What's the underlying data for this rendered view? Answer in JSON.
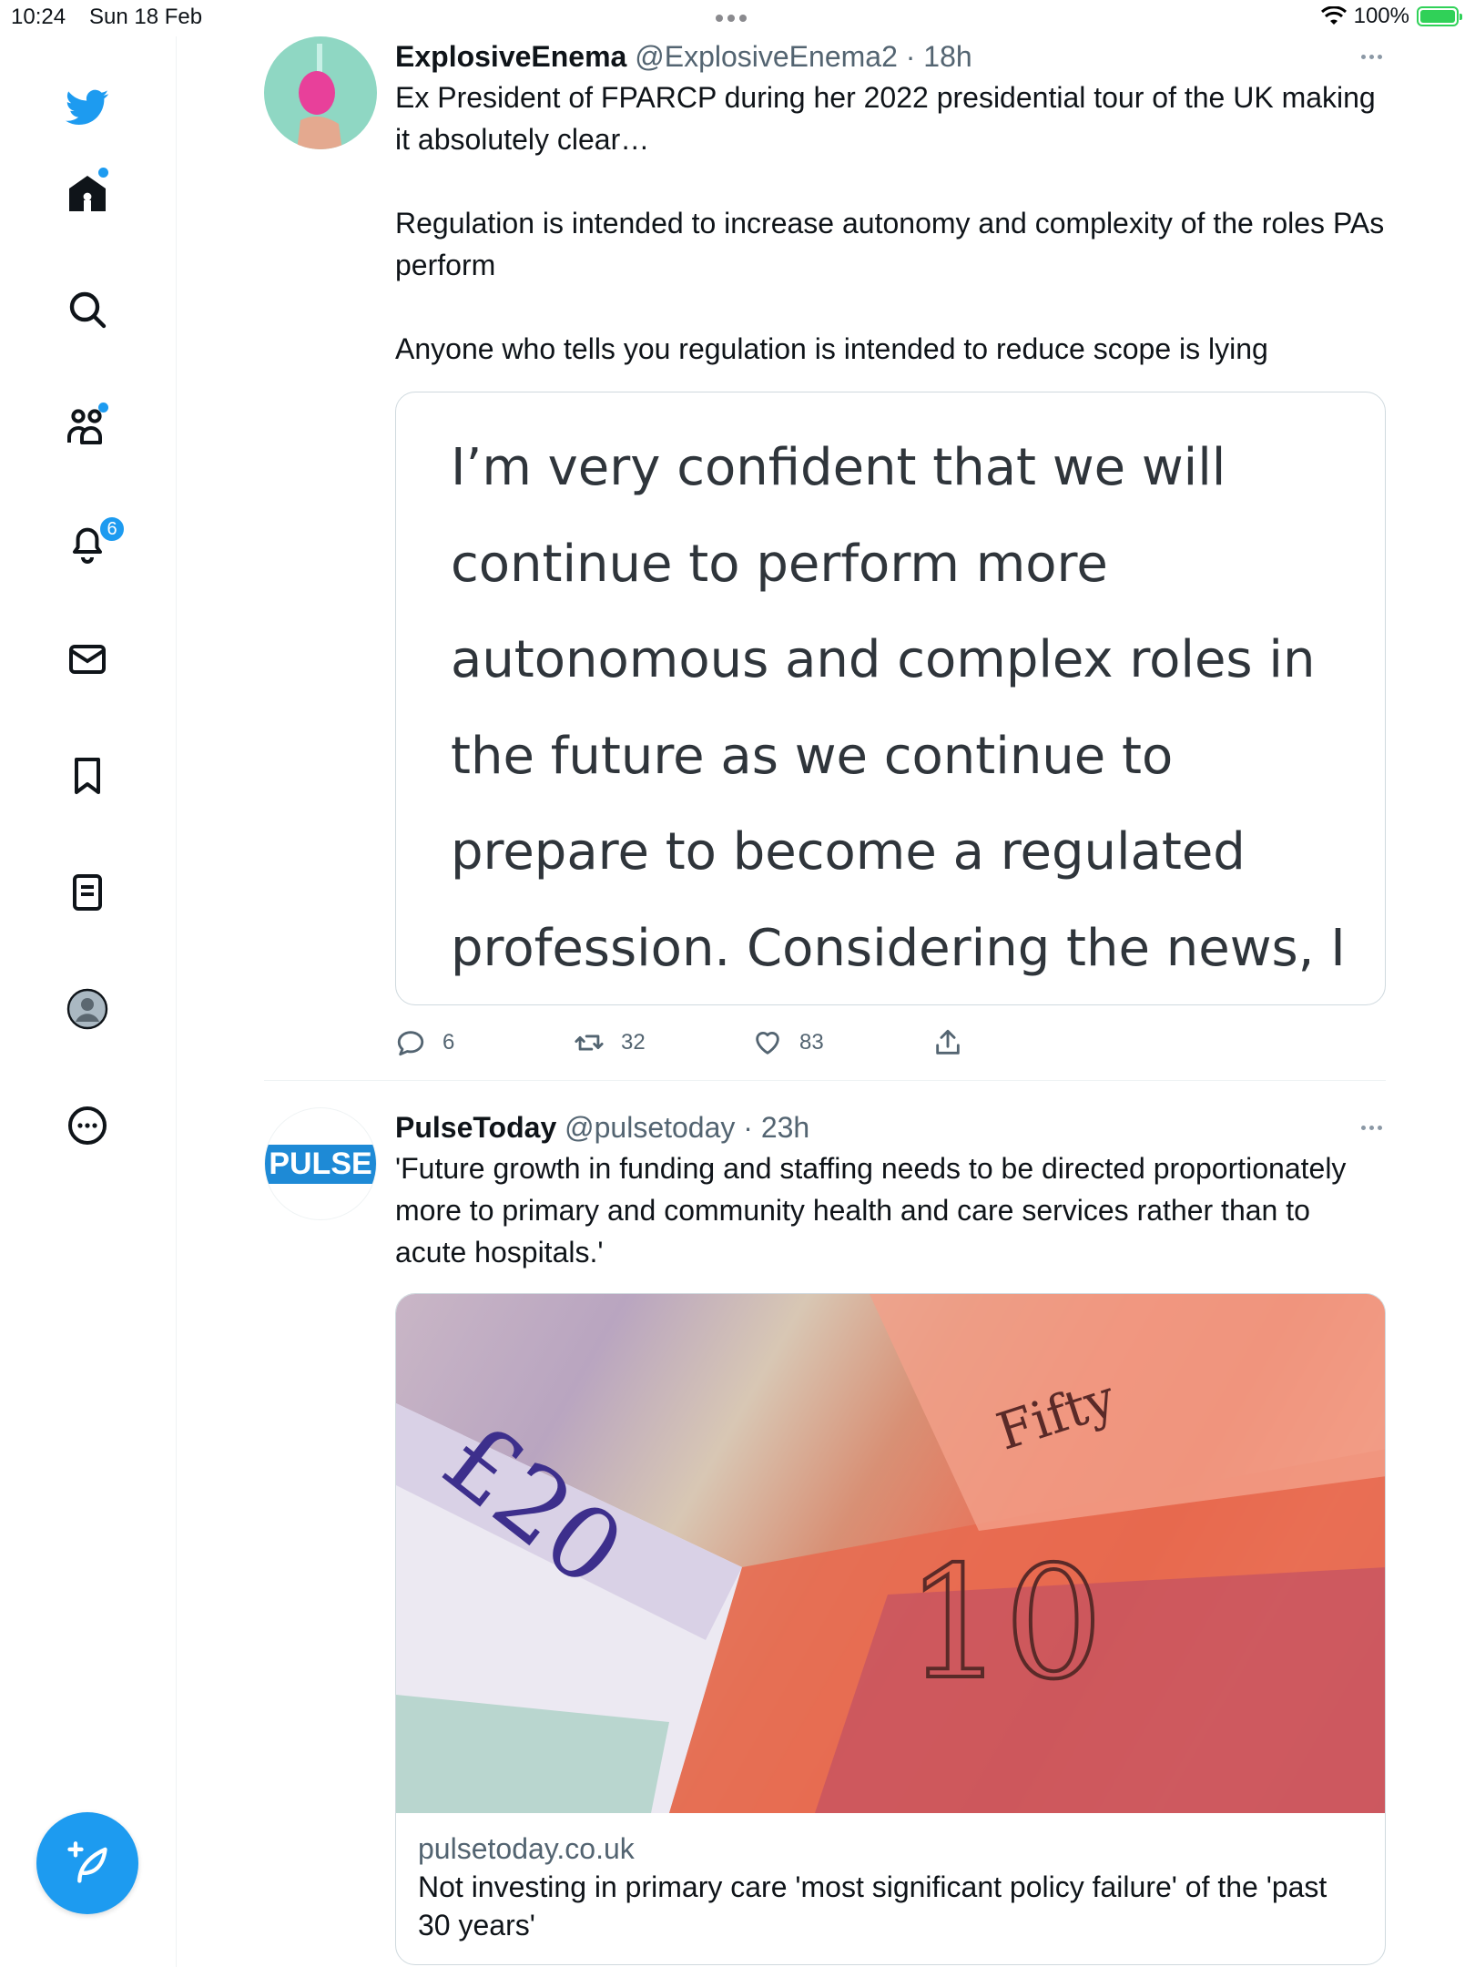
{
  "status_bar": {
    "time": "10:24",
    "date": "Sun 18 Feb",
    "battery": "100%"
  },
  "sidebar": {
    "notifications_count": "6",
    "accent_color": "#1d9bf0"
  },
  "tweets": [
    {
      "name": "ExplosiveEnema",
      "meta": "@ExplosiveEnema2 · 18h",
      "text": [
        "Ex President of FPARCP during her 2022 presidential tour of the UK making it absolutely clear…",
        "Regulation is intended to increase autonomy and complexity of the roles PAs perform",
        "Anyone who tells you regulation is intended to reduce scope is lying"
      ],
      "quote_image_text": "I’m very confident that we will\ncontinue to perform more\nautonomous and complex roles in\nthe future as we continue to\nprepare to become a regulated\nprofession. Considering the news, I",
      "replies": "6",
      "retweets": "32",
      "likes": "83"
    },
    {
      "name": "PulseToday",
      "meta": "@pulsetoday · 23h",
      "avatar_text": "PULSE",
      "text": [
        "'Future growth in funding and staffing needs to be directed proportionately more to primary and community health and care services rather than to acute hospitals.'"
      ],
      "link": {
        "domain": "pulsetoday.co.uk",
        "title": "Not investing in primary care 'most significant policy failure' of the 'past 30 years'",
        "image_labels": [
          "£20",
          "10",
          "Fifty"
        ]
      }
    }
  ]
}
